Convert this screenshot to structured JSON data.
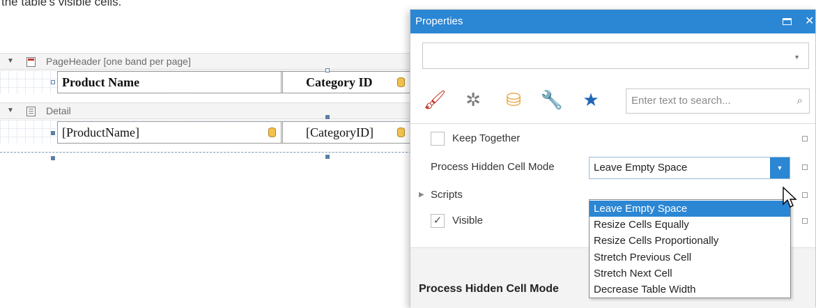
{
  "caption": "the table's visible cells.",
  "designer": {
    "page_header_band": "PageHeader [one band per page]",
    "detail_band": "Detail",
    "header_cells": [
      "Product Name",
      "Category ID"
    ],
    "detail_cells": [
      "[ProductName]",
      "[CategoryID]"
    ]
  },
  "properties": {
    "title": "Properties",
    "object_selector_value": "",
    "tabs": [
      "brush-icon",
      "gear-icon",
      "database-icon",
      "wrench-icon",
      "star-icon"
    ],
    "search_placeholder": "Enter text to search...",
    "rows": {
      "keep_together": {
        "label": "Keep Together",
        "checked": false
      },
      "process_hidden_cell_mode": {
        "label": "Process Hidden Cell Mode",
        "value": "Leave Empty Space"
      },
      "scripts": {
        "label": "Scripts"
      },
      "visible": {
        "label": "Visible",
        "checked": true
      }
    },
    "dropdown_options": [
      "Leave Empty Space",
      "Resize Cells Equally",
      "Resize Cells Proportionally",
      "Stretch Previous Cell",
      "Stretch Next Cell",
      "Decrease Table Width"
    ],
    "selected_option": "Leave Empty Space",
    "description_title": "Process Hidden Cell Mode"
  },
  "colors": {
    "accent": "#2b86d4",
    "title_text": "#ffffff"
  }
}
